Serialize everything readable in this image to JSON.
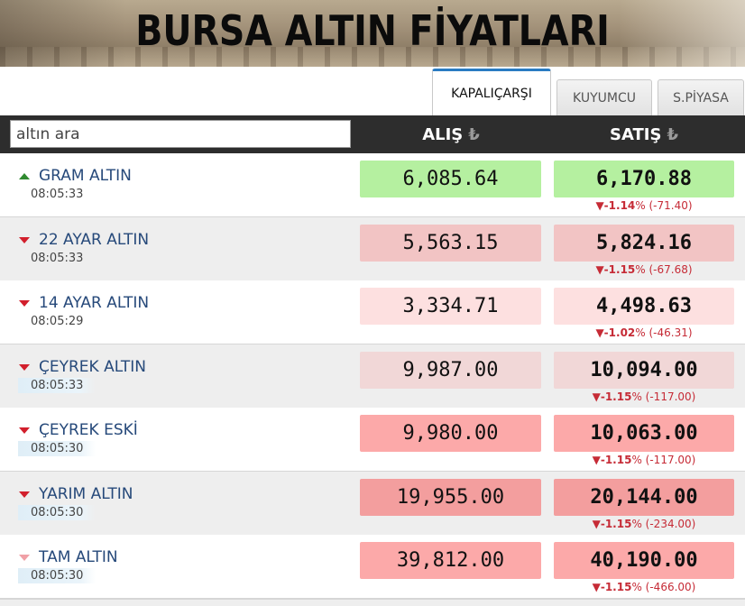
{
  "banner": {
    "title": "BURSA ALTIN FİYATLARI"
  },
  "tabs": [
    {
      "label": "KAPALIÇARŞI",
      "active": true
    },
    {
      "label": "KUYUMCU",
      "active": false
    },
    {
      "label": "S.PİYASA",
      "active": false
    }
  ],
  "search": {
    "placeholder": "altın ara"
  },
  "columns": {
    "alis": "ALIŞ",
    "satis": "SATIŞ",
    "currency_symbol": "₺"
  },
  "colors": {
    "up_green": "#2f8a2f",
    "down_red": "#d21f2c",
    "change_text": "#c62b36",
    "name_blue": "#26497a",
    "header_bg": "#2d2d2d",
    "tab_accent": "#2a7bc2"
  },
  "rows": [
    {
      "name": "GRAM ALTIN",
      "time": "08:05:33",
      "trend": "up-arrow-icon",
      "alis": "6,085.64",
      "satis": "6,170.88",
      "change_pct": "▼-1.14",
      "change_amt": "% (-71.40)",
      "alis_color": "#b5f0a0",
      "satis_color": "#b5f0a0"
    },
    {
      "name": "22 AYAR ALTIN",
      "time": "08:05:33",
      "trend": "down-arrow-icon",
      "alis": "5,563.15",
      "satis": "5,824.16",
      "change_pct": "▼-1.15",
      "change_amt": "% (-67.68)",
      "alis_color": "#f2c4c4",
      "satis_color": "#f2c4c4"
    },
    {
      "name": "14 AYAR ALTIN",
      "time": "08:05:29",
      "trend": "down-arrow-icon",
      "alis": "3,334.71",
      "satis": "4,498.63",
      "change_pct": "▼-1.02",
      "change_amt": "% (-46.31)",
      "alis_color": "#fde0e0",
      "satis_color": "#fde0e0"
    },
    {
      "name": "ÇEYREK ALTIN",
      "time": "08:05:33",
      "trend": "down-arrow-icon",
      "alis": "9,987.00",
      "satis": "10,094.00",
      "change_pct": "▼-1.15",
      "change_amt": "% (-117.00)",
      "alis_color": "#f1d7d7",
      "satis_color": "#f1d7d7"
    },
    {
      "name": "ÇEYREK ESKİ",
      "time": "08:05:30",
      "trend": "down-arrow-icon",
      "alis": "9,980.00",
      "satis": "10,063.00",
      "change_pct": "▼-1.15",
      "change_amt": "% (-117.00)",
      "alis_color": "#fca9a9",
      "satis_color": "#fca9a9"
    },
    {
      "name": "YARIM ALTIN",
      "time": "08:05:30",
      "trend": "down-arrow-icon",
      "alis": "19,955.00",
      "satis": "20,144.00",
      "change_pct": "▼-1.15",
      "change_amt": "% (-234.00)",
      "alis_color": "#f39e9e",
      "satis_color": "#f39e9e"
    },
    {
      "name": "TAM ALTIN",
      "time": "08:05:30",
      "trend": "down-arrow-light-icon",
      "alis": "39,812.00",
      "satis": "40,190.00",
      "change_pct": "▼-1.15",
      "change_amt": "% (-466.00)",
      "alis_color": "#fca9a9",
      "satis_color": "#fca9a9"
    }
  ]
}
